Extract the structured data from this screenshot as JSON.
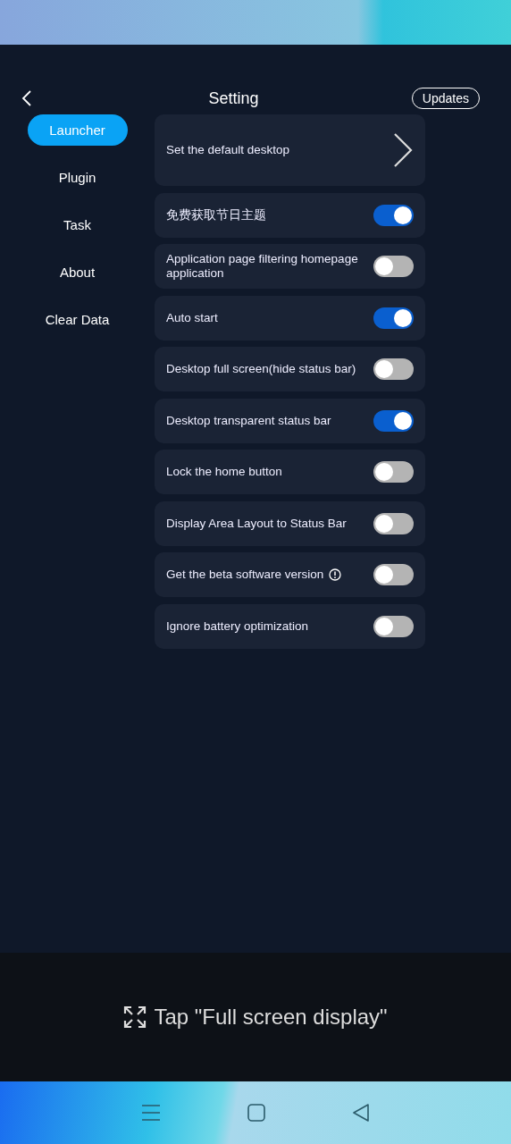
{
  "header": {
    "title": "Setting",
    "updates_button": "Updates"
  },
  "sidebar": {
    "items": [
      {
        "label": "Launcher",
        "selected": true
      },
      {
        "label": "Plugin",
        "selected": false
      },
      {
        "label": "Task",
        "selected": false
      },
      {
        "label": "About",
        "selected": false
      },
      {
        "label": "Clear Data",
        "selected": false
      }
    ]
  },
  "settings": [
    {
      "kind": "link",
      "label": "Set the default desktop"
    },
    {
      "kind": "toggle",
      "label": "免费获取节日主题",
      "on": true
    },
    {
      "kind": "toggle",
      "label": "Application page filtering homepage application",
      "on": false
    },
    {
      "kind": "toggle",
      "label": "Auto start",
      "on": true
    },
    {
      "kind": "toggle",
      "label": "Desktop full screen(hide status bar)",
      "on": false
    },
    {
      "kind": "toggle",
      "label": "Desktop transparent status bar",
      "on": true
    },
    {
      "kind": "toggle",
      "label": "Lock the home button",
      "on": false
    },
    {
      "kind": "toggle",
      "label": "Display Area Layout to Status Bar",
      "on": false
    },
    {
      "kind": "toggle",
      "label": "Get the beta software version",
      "on": false,
      "info": true
    },
    {
      "kind": "toggle",
      "label": "Ignore battery optimization",
      "on": false
    }
  ],
  "hint_bar": {
    "text": "Tap \"Full screen display\""
  }
}
